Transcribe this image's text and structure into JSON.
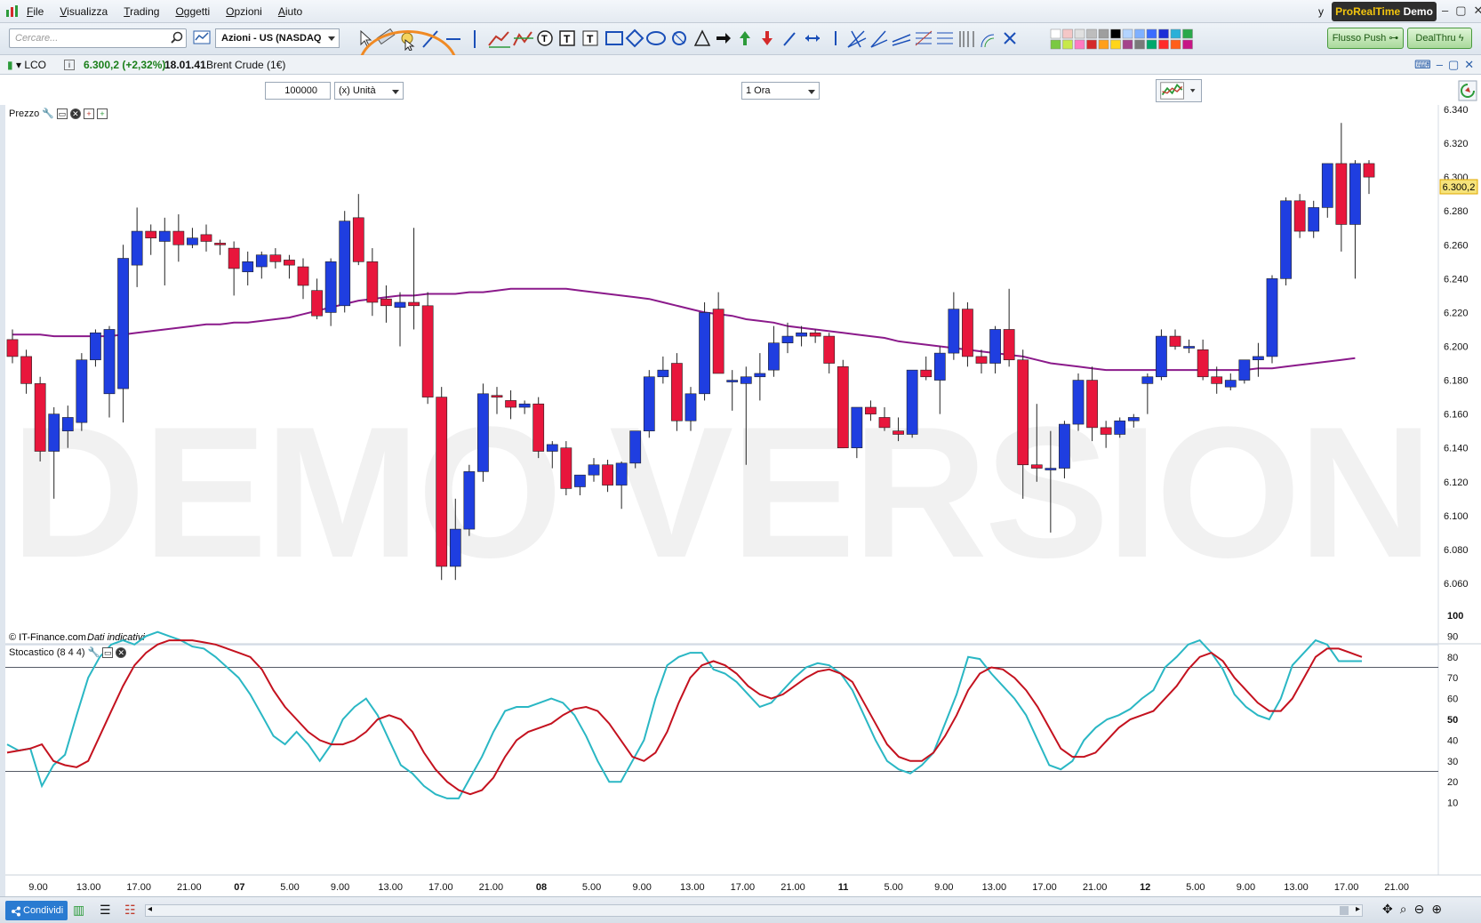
{
  "menu": {
    "items": [
      "File",
      "Visualizza",
      "Trading",
      "Oggetti",
      "Opzioni",
      "Aiuto"
    ],
    "right_letter": "y",
    "brand_left": "ProRealTime",
    "brand_right": "Demo"
  },
  "toolbar": {
    "search_placeholder": "Cercare...",
    "market": "Azioni - US (NASDAQ",
    "flusso_label": "Flusso Push",
    "dealthru_label": "DealThru"
  },
  "instrument": {
    "symbol": "LCO",
    "price": "6.300,2 (+2,32%)",
    "time": "18.01.41",
    "name": "Brent Crude (1€)"
  },
  "controls": {
    "quantity": "100000",
    "unit": "(x) Unità",
    "timeframe": "1 Ora"
  },
  "panes": {
    "price_label": "Prezzo",
    "stoch_label": "Stocastico (8 4 4)",
    "copyright": "© IT-Finance.com",
    "copyright_note": "Dati indicativi",
    "watermark": "DEMO VERSION",
    "last_price_tag": "6.300,2"
  },
  "bottom": {
    "share_label": "Condividi"
  },
  "colors": {
    "bull": "#1f3ee0",
    "bear": "#e8163c",
    "ma": "#8b1a8b",
    "stoch_k": "#2ab7c4",
    "stoch_d": "#c4121f",
    "highlight": "#f08a24"
  },
  "chart_data": [
    {
      "type": "candlestick",
      "title": "Prezzo",
      "y_ticks": [
        "6.340",
        "6.320",
        "6.300",
        "6.280",
        "6.260",
        "6.240",
        "6.220",
        "6.200",
        "6.180",
        "6.160",
        "6.140",
        "6.120",
        "6.100",
        "6.080",
        "6.060"
      ],
      "ylim": [
        6050,
        6350
      ],
      "x_ticks": [
        "9.00",
        "13.00",
        "17.00",
        "21.00",
        "07",
        "5.00",
        "9.00",
        "13.00",
        "17.00",
        "21.00",
        "08",
        "5.00",
        "9.00",
        "13.00",
        "17.00",
        "21.00",
        "11",
        "5.00",
        "9.00",
        "13.00",
        "17.00",
        "21.00",
        "12",
        "5.00",
        "9.00",
        "13.00",
        "17.00",
        "21.00"
      ],
      "x_tick_bold": [
        "07",
        "08",
        "11",
        "12"
      ],
      "candles": [
        [
          6204,
          6210,
          6190,
          6194
        ],
        [
          6194,
          6198,
          6172,
          6178
        ],
        [
          6178,
          6182,
          6132,
          6138
        ],
        [
          6138,
          6164,
          6110,
          6160
        ],
        [
          6150,
          6165,
          6140,
          6158
        ],
        [
          6155,
          6196,
          6150,
          6192
        ],
        [
          6192,
          6210,
          6188,
          6208
        ],
        [
          6172,
          6212,
          6158,
          6210
        ],
        [
          6175,
          6260,
          6155,
          6252
        ],
        [
          6248,
          6282,
          6235,
          6268
        ],
        [
          6268,
          6272,
          6254,
          6264
        ],
        [
          6262,
          6276,
          6236,
          6268
        ],
        [
          6268,
          6278,
          6250,
          6260
        ],
        [
          6260,
          6270,
          6258,
          6264
        ],
        [
          6266,
          6272,
          6256,
          6262
        ],
        [
          6261,
          6263,
          6254,
          6260
        ],
        [
          6258,
          6262,
          6230,
          6246
        ],
        [
          6244,
          6256,
          6236,
          6250
        ],
        [
          6247,
          6256,
          6240,
          6254
        ],
        [
          6254,
          6258,
          6246,
          6250
        ],
        [
          6251,
          6254,
          6240,
          6248
        ],
        [
          6247,
          6252,
          6228,
          6236
        ],
        [
          6233,
          6240,
          6216,
          6218
        ],
        [
          6220,
          6252,
          6212,
          6250
        ],
        [
          6224,
          6280,
          6220,
          6274
        ],
        [
          6276,
          6290,
          6248,
          6250
        ],
        [
          6250,
          6258,
          6218,
          6226
        ],
        [
          6228,
          6236,
          6214,
          6224
        ],
        [
          6223,
          6232,
          6200,
          6226
        ],
        [
          6226,
          6270,
          6210,
          6224
        ],
        [
          6224,
          6232,
          6166,
          6170
        ],
        [
          6170,
          6176,
          6062,
          6070
        ],
        [
          6070,
          6110,
          6062,
          6092
        ],
        [
          6092,
          6130,
          6088,
          6126
        ],
        [
          6126,
          6178,
          6120,
          6172
        ],
        [
          6171,
          6176,
          6160,
          6170
        ],
        [
          6168,
          6174,
          6157,
          6164
        ],
        [
          6164,
          6168,
          6160,
          6166
        ],
        [
          6166,
          6170,
          6134,
          6138
        ],
        [
          6138,
          6144,
          6128,
          6142
        ],
        [
          6140,
          6144,
          6112,
          6116
        ],
        [
          6117,
          6124,
          6112,
          6124
        ],
        [
          6124,
          6134,
          6120,
          6130
        ],
        [
          6130,
          6133,
          6114,
          6118
        ],
        [
          6118,
          6132,
          6104,
          6131
        ],
        [
          6131,
          6150,
          6128,
          6150
        ],
        [
          6150,
          6186,
          6146,
          6182
        ],
        [
          6182,
          6194,
          6178,
          6186
        ],
        [
          6190,
          6196,
          6150,
          6156
        ],
        [
          6156,
          6176,
          6150,
          6172
        ],
        [
          6172,
          6226,
          6168,
          6220
        ],
        [
          6222,
          6232,
          6186,
          6184
        ],
        [
          6180,
          6186,
          6162,
          6180
        ],
        [
          6178,
          6188,
          6130,
          6182
        ],
        [
          6182,
          6196,
          6168,
          6184
        ],
        [
          6186,
          6212,
          6182,
          6202
        ],
        [
          6202,
          6214,
          6196,
          6206
        ],
        [
          6206,
          6212,
          6200,
          6208
        ],
        [
          6208,
          6210,
          6202,
          6206
        ],
        [
          6206,
          6208,
          6184,
          6190
        ],
        [
          6188,
          6192,
          6140,
          6140
        ],
        [
          6140,
          6164,
          6134,
          6164
        ],
        [
          6164,
          6168,
          6156,
          6160
        ],
        [
          6158,
          6164,
          6150,
          6152
        ],
        [
          6150,
          6158,
          6144,
          6148
        ],
        [
          6148,
          6186,
          6146,
          6186
        ],
        [
          6186,
          6194,
          6180,
          6182
        ],
        [
          6180,
          6200,
          6160,
          6196
        ],
        [
          6196,
          6232,
          6192,
          6222
        ],
        [
          6222,
          6226,
          6188,
          6194
        ],
        [
          6194,
          6198,
          6184,
          6190
        ],
        [
          6190,
          6212,
          6184,
          6210
        ],
        [
          6210,
          6234,
          6188,
          6192
        ],
        [
          6192,
          6198,
          6110,
          6130
        ],
        [
          6130,
          6166,
          6120,
          6128
        ],
        [
          6128,
          6150,
          6090,
          6128
        ],
        [
          6128,
          6156,
          6122,
          6154
        ],
        [
          6154,
          6184,
          6150,
          6180
        ],
        [
          6180,
          6188,
          6144,
          6152
        ],
        [
          6152,
          6156,
          6140,
          6148
        ],
        [
          6148,
          6158,
          6146,
          6156
        ],
        [
          6156,
          6160,
          6152,
          6158
        ],
        [
          6178,
          6184,
          6160,
          6182
        ],
        [
          6182,
          6210,
          6180,
          6206
        ],
        [
          6206,
          6210,
          6198,
          6200
        ],
        [
          6200,
          6204,
          6196,
          6200
        ],
        [
          6198,
          6204,
          6180,
          6182
        ],
        [
          6182,
          6188,
          6172,
          6178
        ],
        [
          6176,
          6184,
          6174,
          6180
        ],
        [
          6180,
          6192,
          6178,
          6192
        ],
        [
          6192,
          6202,
          6182,
          6194
        ],
        [
          6194,
          6242,
          6190,
          6240
        ],
        [
          6240,
          6288,
          6236,
          6286
        ],
        [
          6286,
          6290,
          6264,
          6268
        ],
        [
          6268,
          6286,
          6264,
          6282
        ],
        [
          6282,
          6308,
          6276,
          6308
        ],
        [
          6308,
          6332,
          6256,
          6272
        ],
        [
          6272,
          6310,
          6240,
          6308
        ],
        [
          6308,
          6310,
          6290,
          6300
        ]
      ],
      "moving_average": [
        6207,
        6207,
        6207,
        6206,
        6206,
        6206,
        6206,
        6206,
        6207,
        6208,
        6209,
        6210,
        6211,
        6212,
        6213,
        6213,
        6214,
        6214,
        6215,
        6216,
        6217,
        6219,
        6221,
        6223,
        6225,
        6227,
        6228,
        6229,
        6230,
        6230,
        6231,
        6231,
        6231,
        6232,
        6232,
        6233,
        6234,
        6234,
        6234,
        6234,
        6234,
        6233,
        6232,
        6231,
        6230,
        6229,
        6228,
        6226,
        6224,
        6222,
        6220,
        6219,
        6218,
        6216,
        6215,
        6214,
        6212,
        6211,
        6210,
        6209,
        6208,
        6207,
        6206,
        6205,
        6203,
        6202,
        6201,
        6200,
        6199,
        6198,
        6197,
        6196,
        6195,
        6194,
        6192,
        6190,
        6189,
        6188,
        6187,
        6186,
        6186,
        6186,
        6186,
        6186,
        6186,
        6186,
        6186,
        6186,
        6186,
        6186,
        6187,
        6187,
        6188,
        6189,
        6190,
        6191,
        6192,
        6193
      ]
    },
    {
      "type": "line",
      "title": "Stocastico (8 4 4)",
      "y_ticks": [
        "100",
        "90",
        "80",
        "70",
        "60",
        "50",
        "40",
        "30",
        "20",
        "10"
      ],
      "ylim": [
        0,
        100
      ],
      "levels": [
        75,
        25
      ],
      "series": [
        {
          "values": [
            38,
            35,
            36,
            18,
            28,
            33,
            52,
            70,
            80,
            86,
            88,
            86,
            90,
            92,
            90,
            88,
            85,
            84,
            80,
            75,
            70,
            62,
            52,
            42,
            38,
            44,
            38,
            30,
            38,
            50,
            56,
            60,
            52,
            40,
            28,
            24,
            18,
            14,
            12,
            12,
            22,
            32,
            44,
            54,
            56,
            56,
            58,
            60,
            58,
            52,
            42,
            30,
            20,
            20,
            30,
            40,
            60,
            76,
            80,
            82,
            82,
            74,
            72,
            68,
            62,
            56,
            58,
            64,
            70,
            75,
            77,
            76,
            72,
            64,
            52,
            40,
            30,
            26,
            24,
            28,
            34,
            48,
            62,
            80,
            79,
            72,
            66,
            60,
            52,
            40,
            28,
            26,
            30,
            40,
            46,
            50,
            52,
            55,
            60,
            64,
            75,
            80,
            86,
            88,
            82,
            74,
            62,
            56,
            52,
            50,
            60,
            76,
            82,
            88,
            86,
            78,
            78,
            78
          ]
        },
        {
          "values": [
            34,
            35,
            36,
            38,
            30,
            28,
            27,
            30,
            42,
            54,
            66,
            76,
            82,
            86,
            88,
            88,
            88,
            87,
            86,
            84,
            82,
            80,
            74,
            64,
            56,
            50,
            44,
            40,
            38,
            38,
            40,
            44,
            50,
            52,
            50,
            44,
            34,
            26,
            20,
            16,
            14,
            16,
            22,
            32,
            40,
            44,
            46,
            48,
            52,
            55,
            56,
            54,
            48,
            40,
            32,
            30,
            34,
            44,
            58,
            70,
            76,
            78,
            76,
            72,
            66,
            62,
            60,
            62,
            66,
            70,
            73,
            74,
            72,
            68,
            58,
            48,
            38,
            32,
            30,
            30,
            34,
            42,
            52,
            64,
            72,
            75,
            74,
            70,
            64,
            56,
            46,
            36,
            32,
            32,
            34,
            40,
            46,
            50,
            52,
            54,
            60,
            66,
            74,
            80,
            82,
            78,
            70,
            64,
            58,
            54,
            54,
            60,
            70,
            80,
            84,
            84,
            82,
            80
          ]
        }
      ]
    }
  ]
}
